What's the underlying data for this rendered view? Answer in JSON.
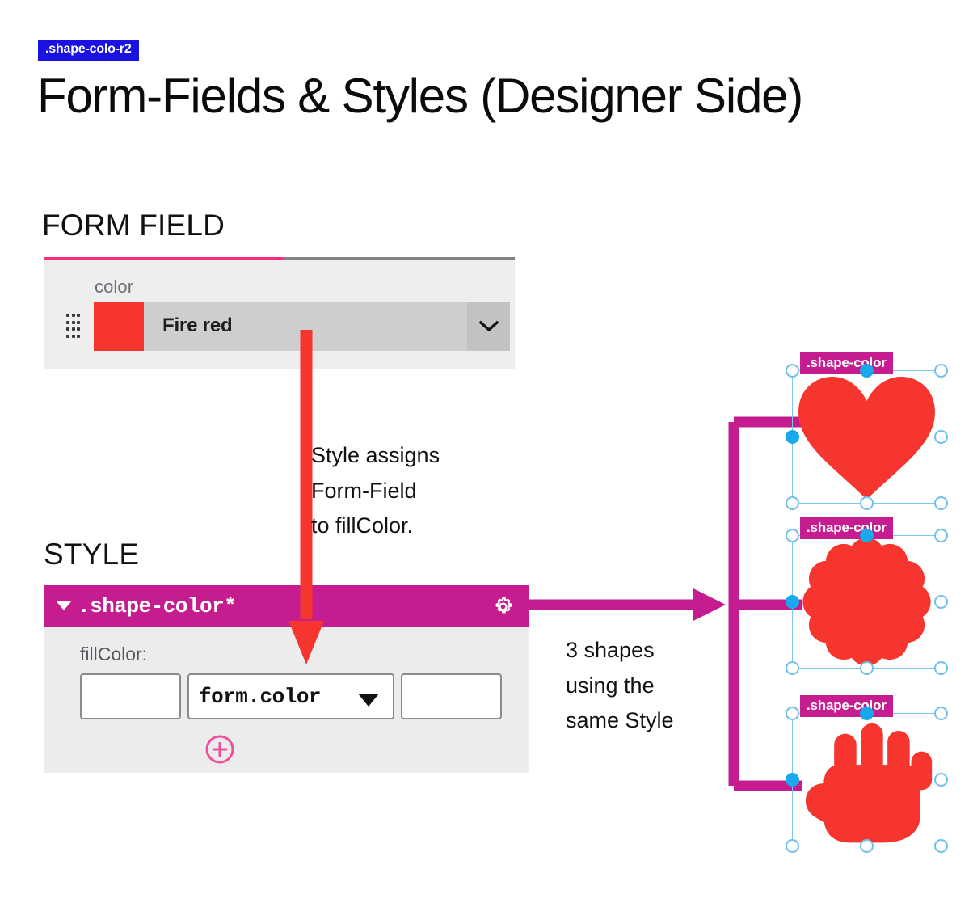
{
  "header": {
    "badge": ".shape-colo-r2",
    "title": "Form-Fields & Styles (Designer Side)"
  },
  "sections": {
    "form_field_heading": "FORM FIELD",
    "style_heading": "STYLE"
  },
  "form_field": {
    "label": "color",
    "selected_value": "Fire red",
    "swatch_color": "#f6352f",
    "accent_color": "#fb2d82",
    "dropdown_icon": "chevron-down-icon",
    "drag_icon": "drag-handle-icon"
  },
  "style_panel": {
    "title": ".shape-color*",
    "header_color": "#c51d8f",
    "collapse_icon": "caret-down-icon",
    "settings_icon": "gear-icon",
    "property_label": "fillColor:",
    "inputs": [
      {
        "name": "left-slot",
        "value": ""
      },
      {
        "name": "binding-slot",
        "value": "form.color"
      },
      {
        "name": "right-slot",
        "value": ""
      }
    ],
    "add_icon": "plus-circle-icon"
  },
  "annotations": {
    "style_assigns": "Style assigns\nForm-Field\nto fillColor.",
    "three_shapes": "3 shapes\nusing the\nsame Style"
  },
  "shapes": [
    {
      "name": "heart-shape",
      "tag": ".shape-color",
      "fill": "#f6352f"
    },
    {
      "name": "flower-shape",
      "tag": ".shape-color",
      "fill": "#f6352f"
    },
    {
      "name": "hand-shape",
      "tag": ".shape-color",
      "fill": "#f6352f"
    }
  ],
  "colors": {
    "magenta": "#c51d8f",
    "red_arrow": "#f6352f",
    "badge_blue": "#1a12e0",
    "selection_blue": "#17a9eb"
  }
}
